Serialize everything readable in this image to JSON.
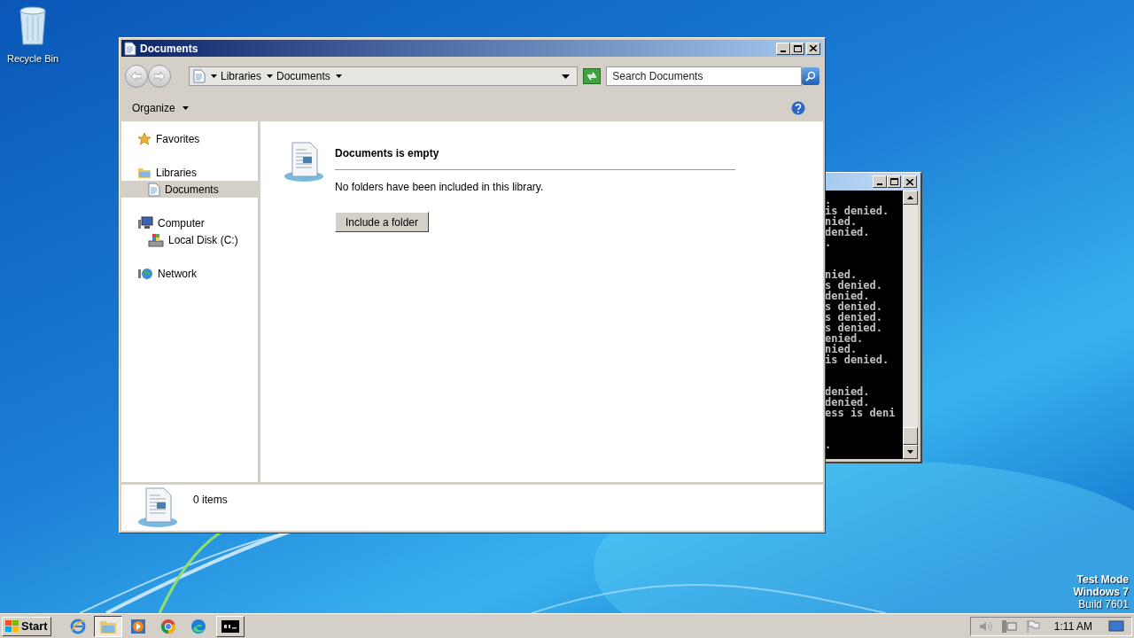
{
  "desktop_icons": [
    {
      "label": "Recycle Bin"
    }
  ],
  "explorer": {
    "title": "Documents",
    "breadcrumb": [
      "Libraries",
      "Documents"
    ],
    "search": {
      "placeholder": "Search Documents"
    },
    "toolbar": {
      "organize": "Organize"
    },
    "nav": [
      {
        "label": "Favorites",
        "kind": "star",
        "selected": false
      },
      {
        "label": "Libraries",
        "kind": "library",
        "selected": false,
        "children": [
          {
            "label": "Documents",
            "kind": "document",
            "selected": true
          }
        ]
      },
      {
        "label": "Computer",
        "kind": "computer",
        "selected": false,
        "children": [
          {
            "label": "Local Disk (C:)",
            "kind": "disk",
            "selected": false
          }
        ]
      },
      {
        "label": "Network",
        "kind": "network",
        "selected": false
      }
    ],
    "empty": {
      "heading": "Documents is empty",
      "message": "No folders have been included in this library.",
      "button": "Include a folder"
    },
    "details": {
      "count": "0 items"
    }
  },
  "console": {
    "blocks": [
      [
        ".",
        "is denied.",
        "nied.",
        "denied.",
        "."
      ],
      [
        "nied.",
        "s denied.",
        "denied.",
        "s denied.",
        "s denied.",
        "s denied.",
        "enied.",
        "nied.",
        "is denied."
      ],
      [
        "denied.",
        "denied.",
        "ess is deni"
      ],
      [
        "."
      ]
    ]
  },
  "watermark": {
    "lines": [
      "Test Mode",
      "Windows 7",
      "Build 7601"
    ]
  },
  "taskbar": {
    "start": "Start",
    "apps": [
      {
        "kind": "ie",
        "selected": false
      },
      {
        "kind": "explorer",
        "selected": true
      },
      {
        "kind": "media",
        "selected": false
      },
      {
        "kind": "chrome",
        "selected": false
      },
      {
        "kind": "edge",
        "selected": false
      },
      {
        "kind": "console",
        "selected": false
      }
    ],
    "clock": "1:11 AM"
  }
}
